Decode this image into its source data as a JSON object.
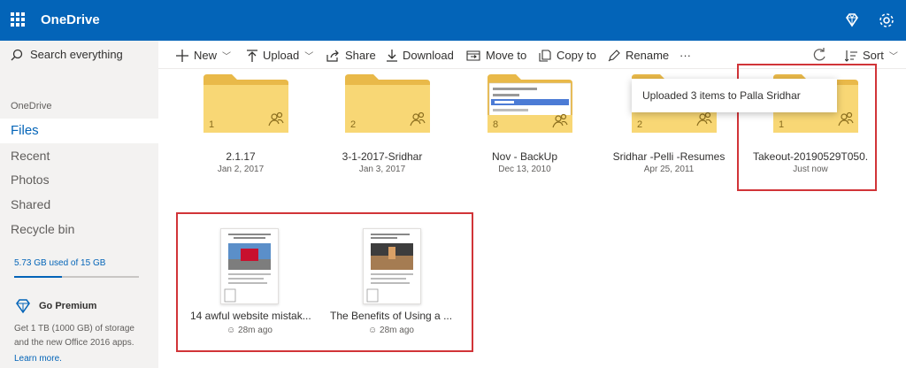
{
  "app": {
    "title": "OneDrive"
  },
  "sidebar": {
    "search_placeholder": "Search everything",
    "section_label": "OneDrive",
    "items": [
      {
        "label": "Files",
        "active": true
      },
      {
        "label": "Recent",
        "active": false
      },
      {
        "label": "Photos",
        "active": false
      },
      {
        "label": "Shared",
        "active": false
      },
      {
        "label": "Recycle bin",
        "active": false
      }
    ],
    "storage_text": "5.73 GB used of 15 GB",
    "storage_fraction": 0.382,
    "premium": {
      "title": "Go Premium",
      "desc": "Get 1 TB (1000 GB) of storage and the new Office 2016 apps.",
      "link": "Learn more."
    }
  },
  "toolbar": {
    "new": "New",
    "upload": "Upload",
    "share": "Share",
    "download": "Download",
    "move_to": "Move to",
    "copy_to": "Copy to",
    "rename": "Rename",
    "more": "···",
    "sort": "Sort"
  },
  "folders": [
    {
      "name": "2.1.17",
      "date": "Jan 2, 2017",
      "count": "1"
    },
    {
      "name": "3-1-2017-Sridhar",
      "date": "Jan 3, 2017",
      "count": "2"
    },
    {
      "name": "Nov - BackUp",
      "date": "Dec 13, 2010",
      "count": "8"
    },
    {
      "name": "Sridhar -Pelli -Resumes",
      "date": "Apr 25, 2011",
      "count": "2"
    },
    {
      "name": "Takeout-20190529T050...",
      "date": "Just now",
      "count": "1"
    }
  ],
  "files": [
    {
      "name": "14 awful website mistak...",
      "date": "28m ago"
    },
    {
      "name": "The Benefits of Using a ...",
      "date": "28m ago"
    }
  ],
  "toast": {
    "text": "Uploaded 3 items to Palla Sridhar"
  },
  "colors": {
    "brand": "#0364b8",
    "folder": "#f8d775",
    "folder_back": "#e9b949",
    "highlight": "#d13438"
  }
}
